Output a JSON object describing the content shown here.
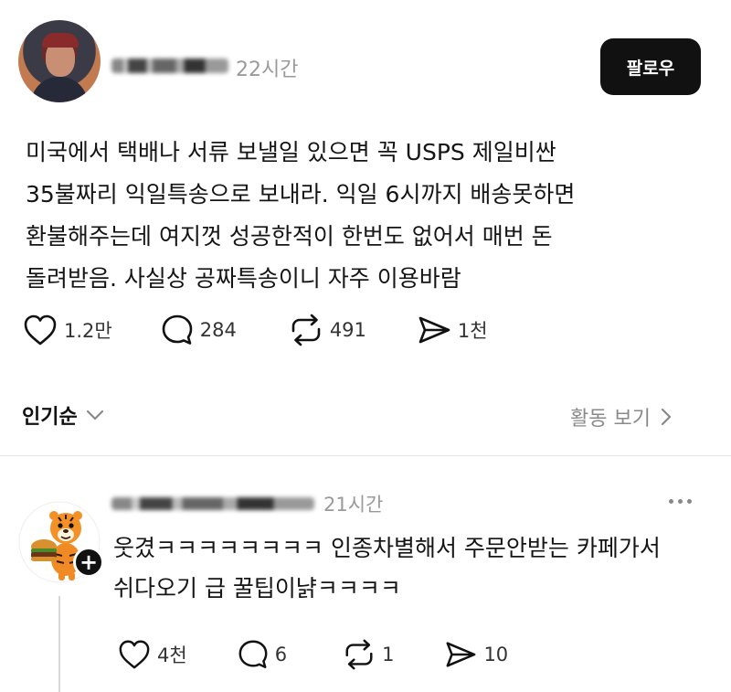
{
  "post": {
    "time": "22시간",
    "follow_label": "팔로우",
    "body_lines": [
      "미국에서 택배나 서류 보낼일 있으면 꼭 USPS 제일비싼",
      "35불짜리 익일특송으로 보내라. 익일 6시까지 배송못하면",
      "환불해주는데 여지껏 성공한적이 한번도 없어서 매번 돈",
      "돌려받음. 사실상 공짜특송이니 자주 이용바람"
    ],
    "likes": "1.2만",
    "comments": "284",
    "reposts": "491",
    "shares": "1천"
  },
  "replies_header": {
    "sort_label": "인기순",
    "activity_label": "활동 보기"
  },
  "reply": {
    "time": "21시간",
    "body_lines": [
      "웃겼ㅋㅋㅋㅋㅋㅋㅋㅋ 인종차별해서 주문안받는 카페가서",
      "쉬다오기 급 꿀팁이냙ㅋㅋㅋㅋ"
    ],
    "likes": "4천",
    "comments": "6",
    "reposts": "1",
    "shares": "10"
  },
  "icons": {
    "like": "heart-icon",
    "comment": "speech-bubble-icon",
    "repost": "repost-icon",
    "share": "send-icon",
    "sort": "chevron-down-icon",
    "activity": "chevron-right-icon",
    "more": "more-icon",
    "follow": "plus-icon"
  }
}
